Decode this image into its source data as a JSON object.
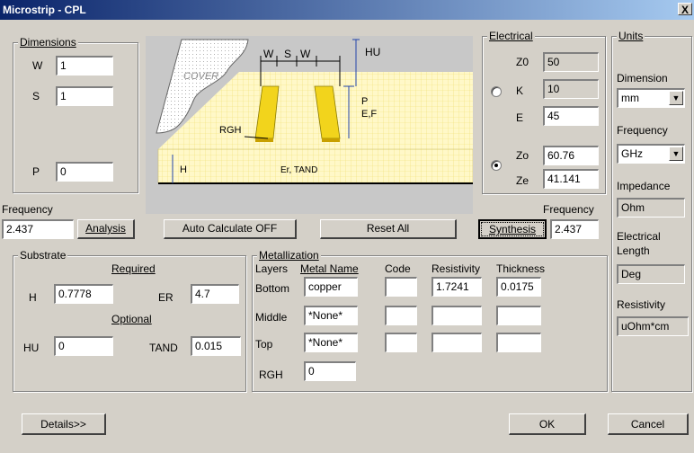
{
  "window": {
    "title": "Microstrip - CPL",
    "close_glyph": "X"
  },
  "dimensions": {
    "group_label": "Dimensions",
    "w_label": "W",
    "w_value": "1",
    "s_label": "S",
    "s_value": "1",
    "p_label": "P",
    "p_value": "0"
  },
  "diagram": {
    "cover": "COVER",
    "w1": "W",
    "s": "S",
    "w2": "W",
    "hu": "HU",
    "rgh": "RGH",
    "p": "P",
    "ef": "E,F",
    "h": "H",
    "er_tand": "Er, TAND"
  },
  "frequency_left": {
    "label": "Frequency",
    "value": "2.437",
    "analysis_button": "Analysis"
  },
  "buttons": {
    "auto_calc": "Auto Calculate OFF",
    "reset_all": "Reset  All",
    "synthesis": "Synthesis",
    "details": "Details>>",
    "ok": "OK",
    "cancel": "Cancel"
  },
  "electrical": {
    "group_label": "Electrical",
    "z0_label": "Z0",
    "z0_value": "50",
    "k_label": "K",
    "k_value": "10",
    "e_label": "E",
    "e_value": "45",
    "zo_label": "Zo",
    "zo_value": "60.76",
    "ze_label": "Ze",
    "ze_value": "41.141",
    "frequency_label": "Frequency",
    "frequency_value": "2.437"
  },
  "units": {
    "group_label": "Units",
    "dimension_label": "Dimension",
    "dimension_value": "mm",
    "frequency_label": "Frequency",
    "frequency_value": "GHz",
    "impedance_label": "Impedance",
    "impedance_value": "Ohm",
    "elec_length_label_1": "Electrical",
    "elec_length_label_2": "Length",
    "elec_length_value": "Deg",
    "resistivity_label": "Resistivity",
    "resistivity_value": "uOhm*cm"
  },
  "substrate": {
    "group_label": "Substrate",
    "required_label": "Required",
    "h_label": "H",
    "h_value": "0.7778",
    "er_label": "ER",
    "er_value": "4.7",
    "optional_label": "Optional",
    "hu_label": "HU",
    "hu_value": "0",
    "tand_label": "TAND",
    "tand_value": "0.015"
  },
  "metallization": {
    "group_label": "Metallization",
    "headers": {
      "layers": "Layers",
      "metal_name": "Metal Name",
      "code": "Code",
      "resistivity": "Resistivity",
      "thickness": "Thickness"
    },
    "rows": [
      {
        "layer": "Bottom",
        "metal": "copper",
        "code": "",
        "resistivity": "1.7241",
        "thickness": "0.0175"
      },
      {
        "layer": "Middle",
        "metal": "*None*",
        "code": "",
        "resistivity": "",
        "thickness": ""
      },
      {
        "layer": "Top",
        "metal": "*None*",
        "code": "",
        "resistivity": "",
        "thickness": ""
      }
    ],
    "rgh_label": "RGH",
    "rgh_value": "0"
  },
  "colors": {
    "strip": "#f2d41c",
    "substrate": "#fff8c8",
    "title_start": "#0a246a",
    "title_end": "#a6caf0"
  }
}
